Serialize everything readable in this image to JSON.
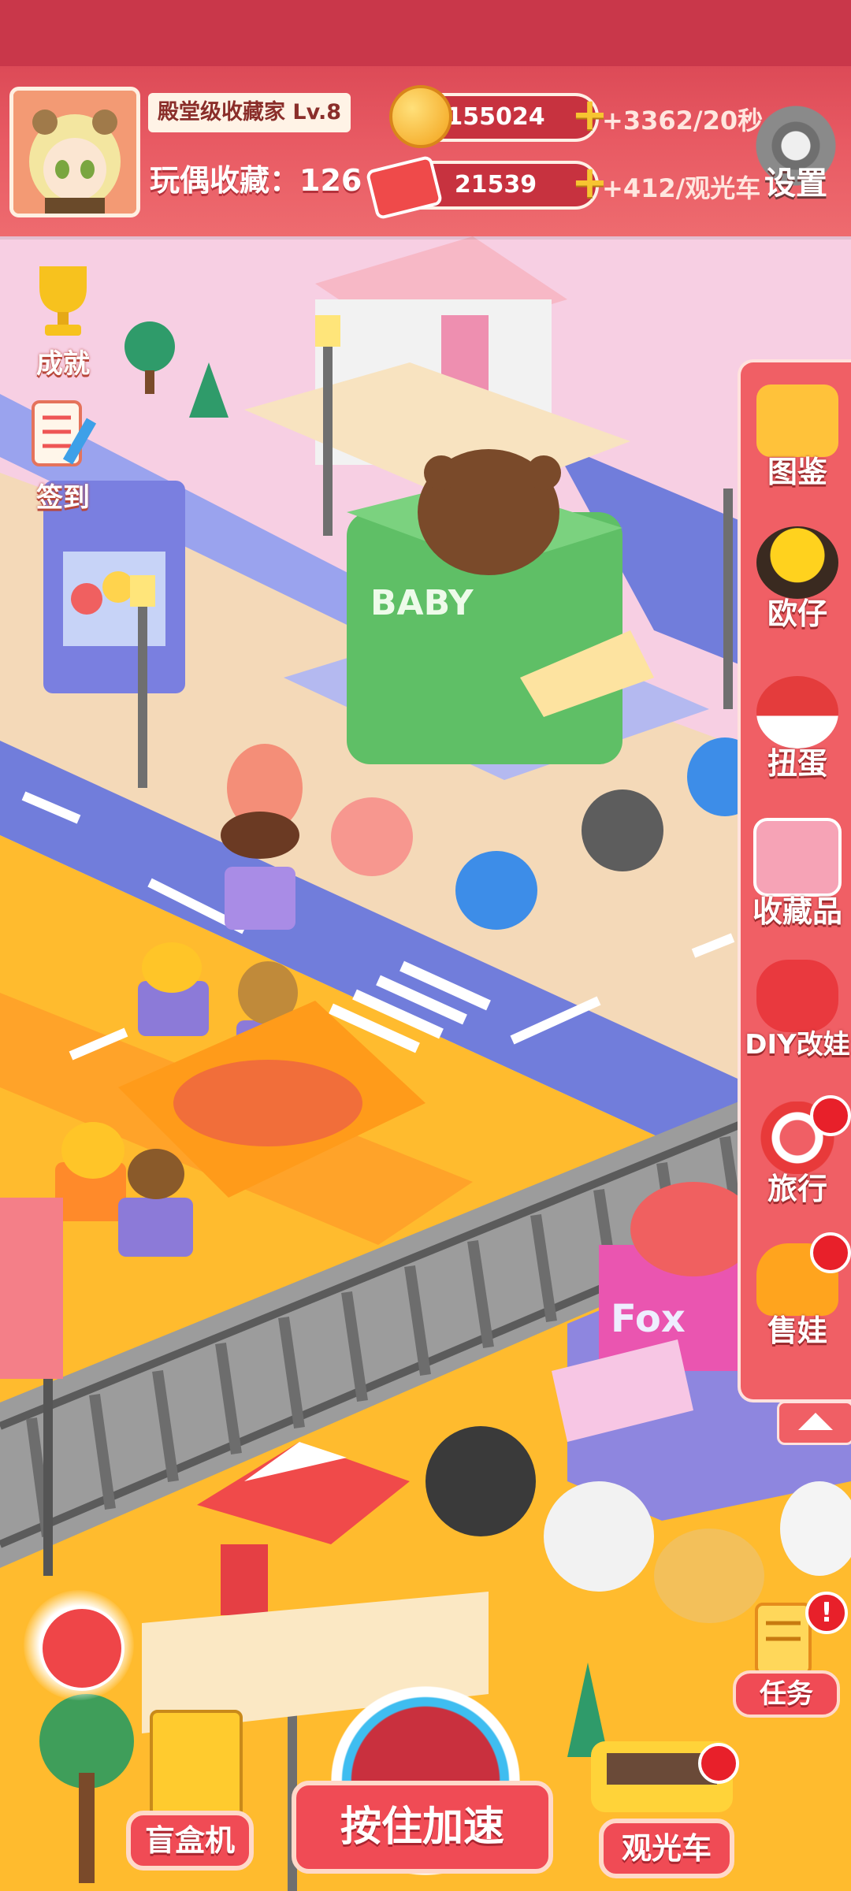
{
  "profile": {
    "rank_text": "殿堂级收藏家 Lv.8",
    "collect_label": "玩偶收藏：",
    "collect_count": "126"
  },
  "currency": {
    "coins": "155024",
    "coin_rate": "+3362/20秒",
    "tickets": "21539",
    "ticket_rate": "+412/观光车"
  },
  "settings_label": "设置",
  "left_buttons": {
    "achievement": "成就",
    "checkin": "签到"
  },
  "right_menu": [
    {
      "label": "图鉴",
      "icon": "folder-icon",
      "badge": false
    },
    {
      "label": "欧仔",
      "icon": "egg-character-icon",
      "badge": false
    },
    {
      "label": "扭蛋",
      "icon": "capsule-icon",
      "badge": false
    },
    {
      "label": "收藏品",
      "icon": "collection-box-icon",
      "badge": false
    },
    {
      "label": "DIY改娃",
      "icon": "gamepad-icon",
      "badge": false
    },
    {
      "label": "旅行",
      "icon": "lifebuoy-icon",
      "badge": true
    },
    {
      "label": "售娃",
      "icon": "gummy-bear-icon",
      "badge": true
    }
  ],
  "bottom": {
    "blind_box": "盲盒机",
    "speed_up": "按住加速",
    "tour_bus": "观光车",
    "task": "任务"
  },
  "world_signs": {
    "baby_shop": "BABY",
    "fox_shop": "Fox"
  },
  "colors": {
    "hud_red": "#d23c4c",
    "menu_red": "#f05f65",
    "road_blue": "#6e78d8",
    "ground_yellow": "#ffb52e",
    "badge_red": "#e8202a"
  }
}
